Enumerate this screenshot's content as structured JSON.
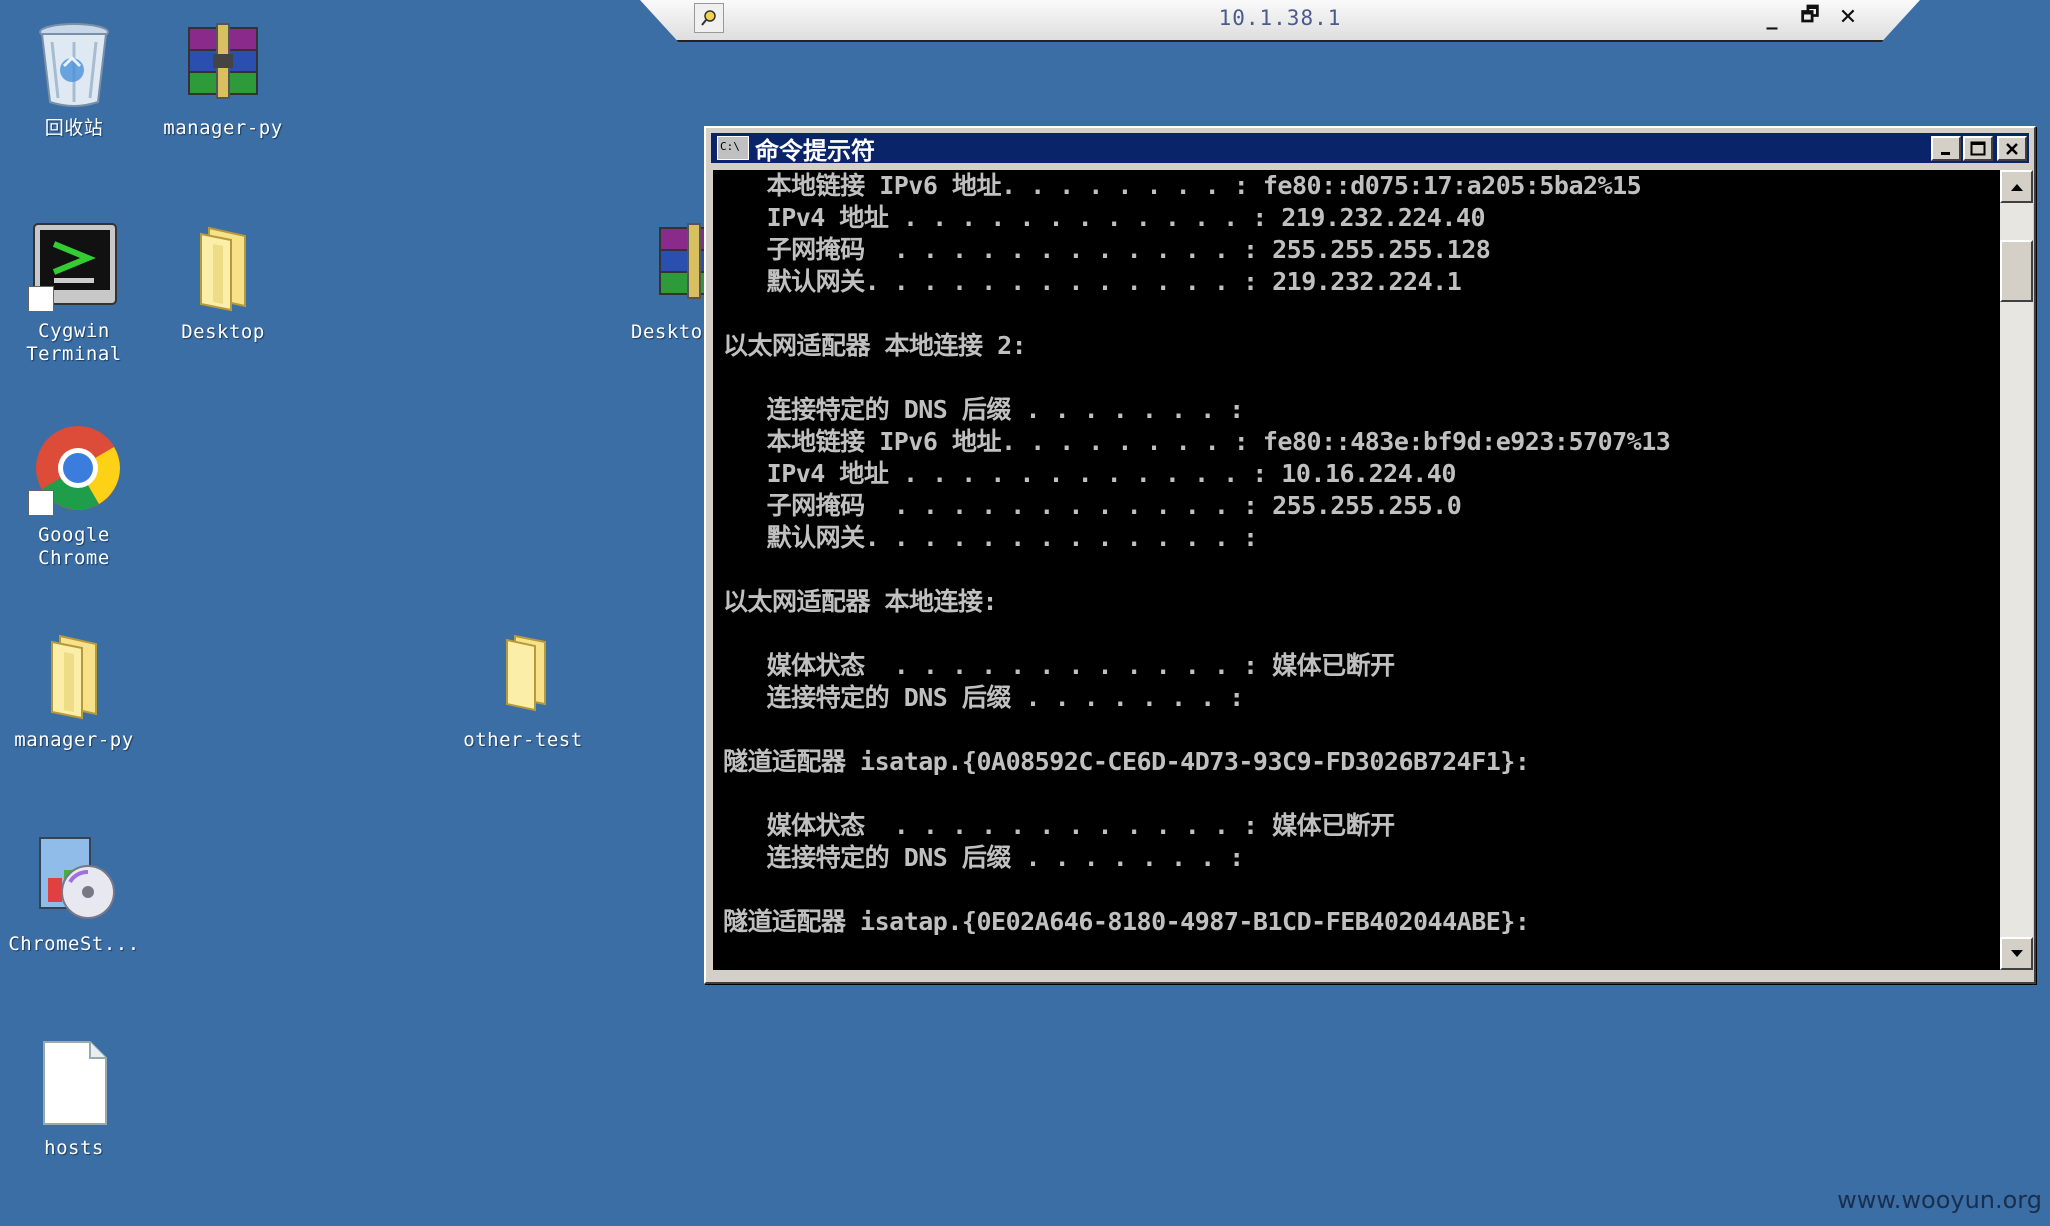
{
  "desktop": {
    "icons": [
      {
        "label": "回收站",
        "icon": "recycle-bin-icon"
      },
      {
        "label": "manager-py",
        "icon": "winrar-archive-icon"
      },
      {
        "label": "Cygwin Terminal",
        "icon": "cygwin-terminal-icon"
      },
      {
        "label": "Desktop",
        "icon": "folder-icon"
      },
      {
        "label": "Deskto",
        "icon": "winrar-archive-icon"
      },
      {
        "label": "Google Chrome",
        "icon": "chrome-icon"
      },
      {
        "label": "manager-py",
        "icon": "folder-icon"
      },
      {
        "label": "other-test",
        "icon": "folder-icon"
      },
      {
        "label": "ChromeSt...",
        "icon": "installer-cd-icon"
      },
      {
        "label": "hosts",
        "icon": "file-icon"
      }
    ]
  },
  "rdp_bar": {
    "title": "10.1.38.1",
    "minimize": "_",
    "restore": "🗗",
    "close": "✕"
  },
  "cmd": {
    "title": "命令提示符",
    "icon_text": "C:\\",
    "lines": [
      "   本地链接 IPv6 地址. . . . . . . . : fe80::d075:17:a205:5ba2%15",
      "   IPv4 地址 . . . . . . . . . . . . : 219.232.224.40",
      "   子网掩码  . . . . . . . . . . . . : 255.255.255.128",
      "   默认网关. . . . . . . . . . . . . : 219.232.224.1",
      "",
      "以太网适配器 本地连接 2:",
      "",
      "   连接特定的 DNS 后缀 . . . . . . . :",
      "   本地链接 IPv6 地址. . . . . . . . : fe80::483e:bf9d:e923:5707%13",
      "   IPv4 地址 . . . . . . . . . . . . : 10.16.224.40",
      "   子网掩码  . . . . . . . . . . . . : 255.255.255.0",
      "   默认网关. . . . . . . . . . . . . :",
      "",
      "以太网适配器 本地连接:",
      "",
      "   媒体状态  . . . . . . . . . . . . : 媒体已断开",
      "   连接特定的 DNS 后缀 . . . . . . . :",
      "",
      "隧道适配器 isatap.{0A08592C-CE6D-4D73-93C9-FD3026B724F1}:",
      "",
      "   媒体状态  . . . . . . . . . . . . : 媒体已断开",
      "   连接特定的 DNS 后缀 . . . . . . . :",
      "",
      "隧道适配器 isatap.{0E02A646-8180-4987-B1CD-FEB402044ABE}:"
    ]
  },
  "watermark": "www.wooyun.org",
  "colors": {
    "desktop": "#3a6ea5",
    "titlebar": "#0a246a",
    "console_bg": "#000000",
    "console_fg": "#c0c0c0"
  }
}
